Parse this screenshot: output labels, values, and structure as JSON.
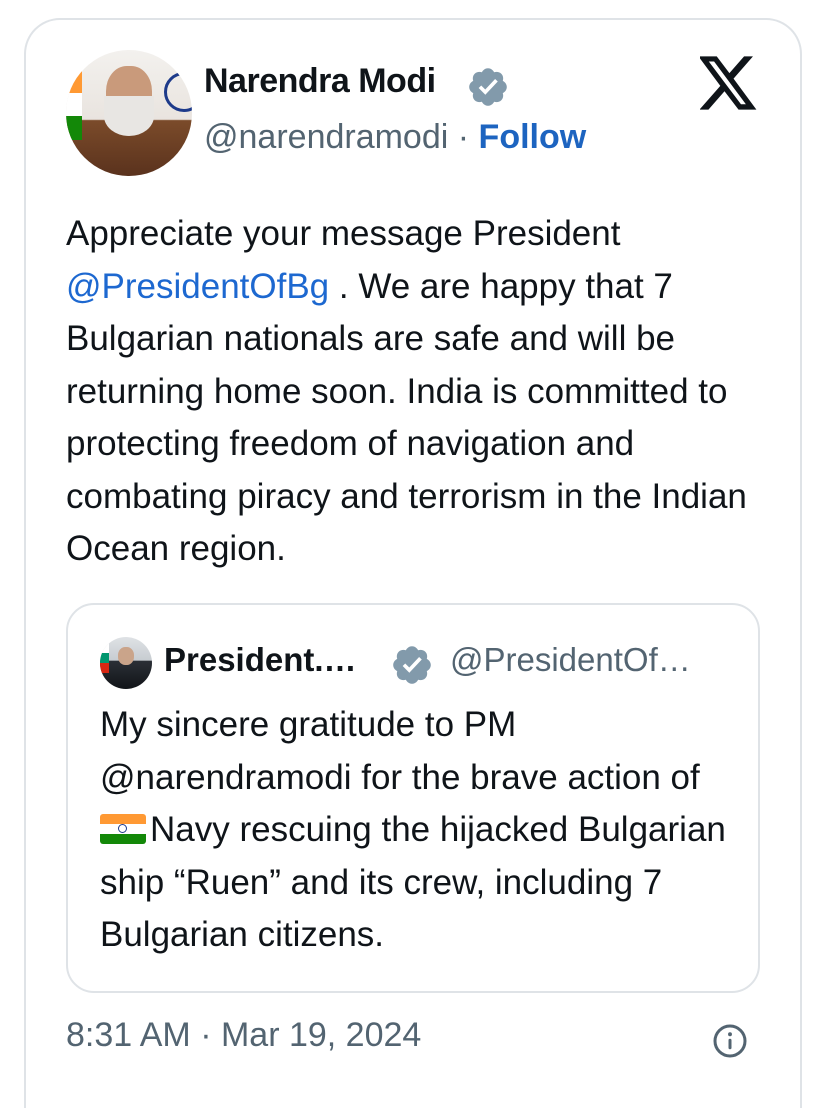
{
  "author": {
    "name": "Narendra Modi",
    "handle": "@narendramodi",
    "separator": "·",
    "follow_label": "Follow",
    "verified_icon": "verified-badge-icon",
    "avatar_icon": "avatar"
  },
  "platform_icon": "x-logo-icon",
  "post": {
    "text_before_mention": "Appreciate your message President ",
    "mention": "@PresidentOfBg",
    "text_after_mention": " . We are happy that 7 Bulgarian nationals are safe and will be returning home soon. India is committed to protecting freedom of navigation and combating piracy and terrorism in the Indian Ocean region."
  },
  "quoted_post": {
    "author_name": "President.…",
    "author_handle": "@PresidentOf…",
    "text_part1": "My sincere gratitude to PM @narendramodi for the brave action of ",
    "inline_flag": "india-flag-emoji",
    "text_part2": "Navy rescuing the hijacked Bulgarian ship “Ruen” and its crew, including 7 Bulgarian citizens."
  },
  "timestamp": "8:31 AM · Mar 19, 2024",
  "info_icon": "info-icon",
  "colors": {
    "text": "#0f1419",
    "secondary": "#536471",
    "link": "#1d68d0",
    "verified": "#829aab",
    "border": "#dfe3e7"
  }
}
